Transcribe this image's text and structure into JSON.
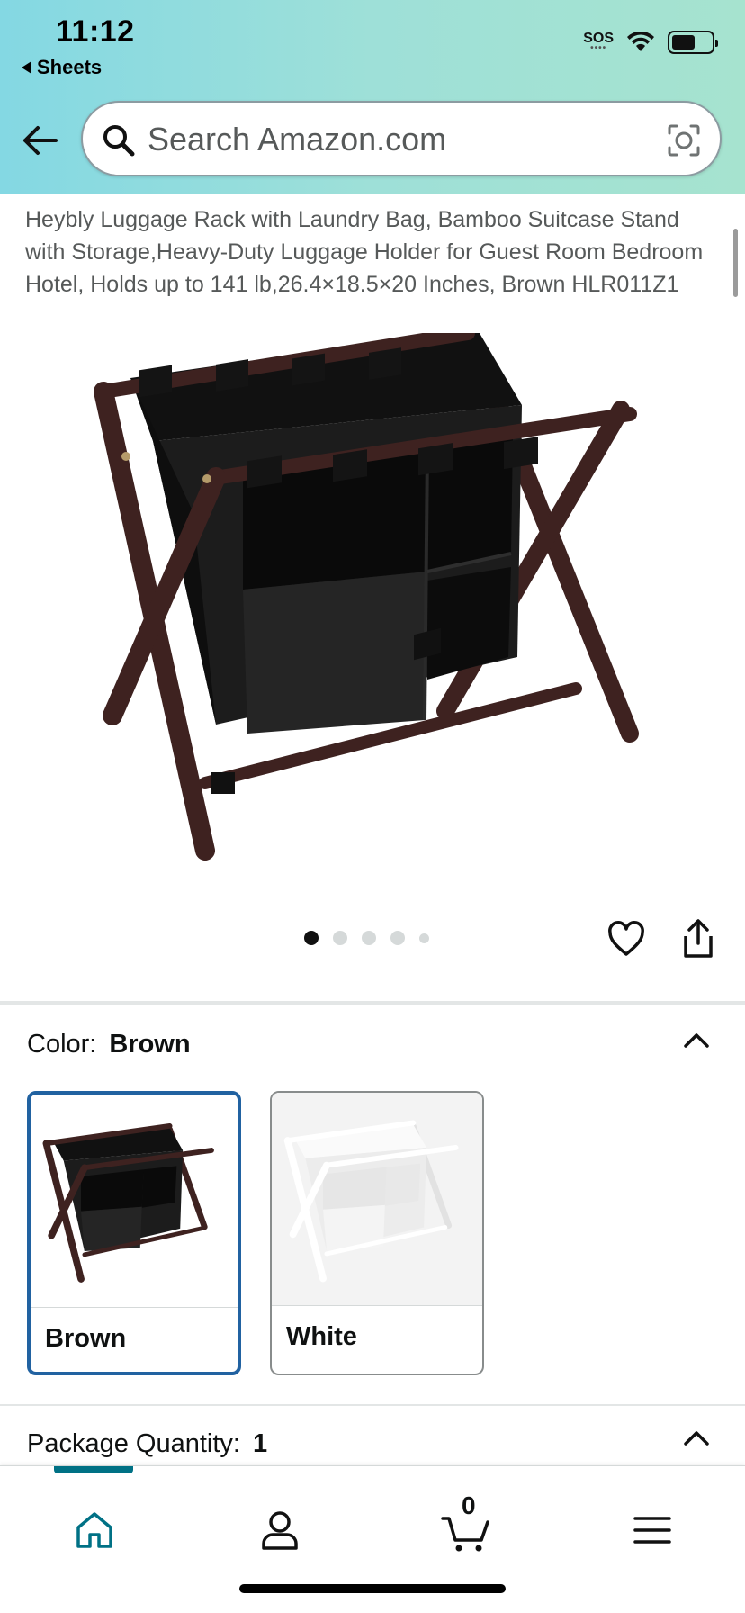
{
  "status_bar": {
    "time": "11:12",
    "back_app": "Sheets",
    "sos": "SOS"
  },
  "search": {
    "placeholder": "Search Amazon.com"
  },
  "product": {
    "title": "Heybly Luggage Rack with Laundry Bag, Bamboo Suitcase Stand with Storage,Heavy-Duty Luggage Holder for Guest Room Bedroom Hotel, Holds up to 141 lb,26.4×18.5×20 Inches, Brown HLR011Z1",
    "image_count": 5,
    "active_image": 1
  },
  "color": {
    "label": "Color:",
    "selected": "Brown",
    "options": [
      {
        "label": "Brown"
      },
      {
        "label": "White"
      }
    ]
  },
  "package": {
    "label": "Package Quantity:",
    "value": "1"
  },
  "bottom_nav": {
    "items": [
      "home-icon",
      "account-icon",
      "cart-icon",
      "menu-icon"
    ],
    "cart_count": "0",
    "active": "home"
  },
  "colors": {
    "accent": "#007185",
    "selected_border": "#2162a1",
    "wood": "#3e2220",
    "fabric": "#1b1b1b"
  }
}
